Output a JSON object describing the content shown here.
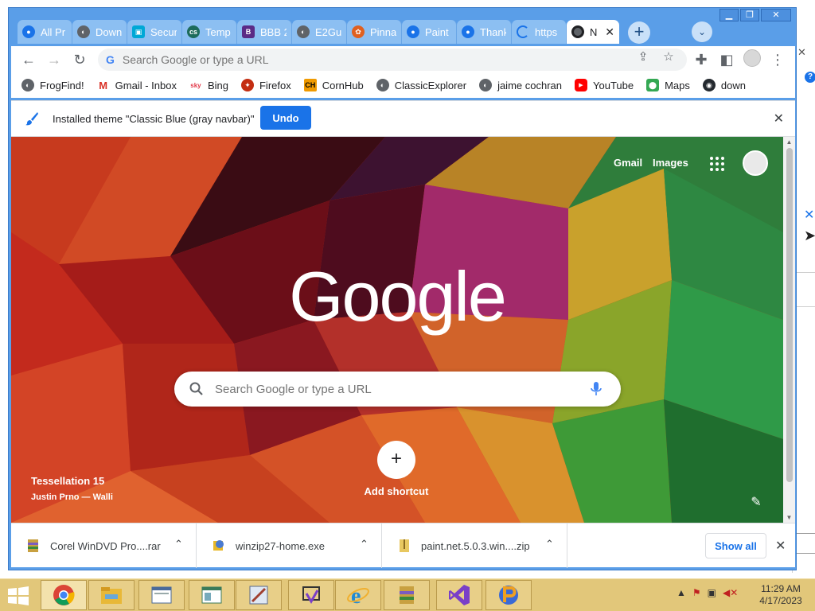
{
  "tabs": [
    {
      "title": "All Pr",
      "icon": "blue-balloon-icon",
      "color": "#1a73e8"
    },
    {
      "title": "Down",
      "icon": "globe-icon",
      "color": "#5f6368"
    },
    {
      "title": "Secur",
      "icon": "cube-icon",
      "color": "#00a8d6"
    },
    {
      "title": "Temp",
      "icon": "cs-icon",
      "color": "#1d6b5b"
    },
    {
      "title": "BBB 2",
      "icon": "bbb-icon",
      "color": "#5b2a86"
    },
    {
      "title": "E2Gu",
      "icon": "globe-icon",
      "color": "#5f6368"
    },
    {
      "title": "Pinna",
      "icon": "pinnacle-icon",
      "color": "#e06020"
    },
    {
      "title": "Paint",
      "icon": "blue-balloon-icon",
      "color": "#1a73e8"
    },
    {
      "title": "Thank",
      "icon": "blue-balloon-icon",
      "color": "#1a73e8"
    },
    {
      "title": "https",
      "icon": "loading-icon",
      "color": "#1a73e8"
    }
  ],
  "active_tab": {
    "title": "N",
    "icon": "chrome-icon"
  },
  "toolbar": {
    "omnibox_placeholder": "Search Google or type a URL"
  },
  "bookmarks": [
    {
      "label": "FrogFind!",
      "icon": "globe-icon",
      "color": "#5f6368"
    },
    {
      "label": "Gmail - Inbox",
      "icon": "gmail-icon",
      "color": "#d93025"
    },
    {
      "label": "Bing",
      "icon": "sky-icon",
      "color": "#e23a4a"
    },
    {
      "label": "Firefox",
      "icon": "firefox-icon",
      "color": "#c42e12"
    },
    {
      "label": "CornHub",
      "icon": "ch-icon",
      "color": "#f09a00"
    },
    {
      "label": "ClassicExplorer",
      "icon": "globe-icon",
      "color": "#5f6368"
    },
    {
      "label": "jaime cochran",
      "icon": "globe-icon",
      "color": "#5f6368"
    },
    {
      "label": "YouTube",
      "icon": "youtube-icon",
      "color": "#ff0000"
    },
    {
      "label": "Maps",
      "icon": "maps-icon",
      "color": "#34a853"
    },
    {
      "label": "down",
      "icon": "github-icon",
      "color": "#24292f"
    }
  ],
  "infobar": {
    "message": "Installed theme \"Classic Blue (gray navbar)\"",
    "undo_label": "Undo"
  },
  "ntp": {
    "gmail_link": "Gmail",
    "images_link": "Images",
    "logo_text": "Google",
    "search_placeholder": "Search Google or type a URL",
    "add_shortcut_label": "Add shortcut",
    "background_title": "Tessellation 15",
    "background_author": "Justin Prno — Walli"
  },
  "downloads": [
    {
      "name": "Corel WinDVD Pro....rar",
      "icon": "archive-icon"
    },
    {
      "name": "winzip27-home.exe",
      "icon": "installer-icon"
    },
    {
      "name": "paint.net.5.0.3.win....zip",
      "icon": "zip-icon"
    }
  ],
  "download_shelf": {
    "show_all_label": "Show all"
  },
  "taskbar": {
    "time": "11:29 AM",
    "date": "4/17/2023",
    "apps": [
      {
        "name": "chrome",
        "icon": "chrome-icon"
      },
      {
        "name": "file-explorer",
        "icon": "folder-icon"
      },
      {
        "name": "window-app-1",
        "icon": "window-icon"
      },
      {
        "name": "window-app-2",
        "icon": "window-icon"
      },
      {
        "name": "paint-app",
        "icon": "paint-icon"
      },
      {
        "name": "visual-studio-installer",
        "icon": "vs-installer-icon"
      },
      {
        "name": "internet-explorer",
        "icon": "ie-icon"
      },
      {
        "name": "archive-app",
        "icon": "archive-icon"
      },
      {
        "name": "visual-studio",
        "icon": "vs-icon"
      },
      {
        "name": "paint-net",
        "icon": "paintnet-icon"
      }
    ]
  },
  "colors": {
    "frame": "#5a9ee8",
    "accent": "#1a73e8",
    "taskbar": "#e2c77a"
  }
}
